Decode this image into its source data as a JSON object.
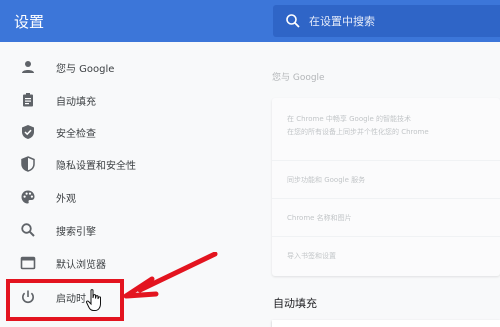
{
  "header": {
    "title": "设置",
    "search_placeholder": "在设置中搜索"
  },
  "sidebar": {
    "items": [
      {
        "label": "您与 Google",
        "icon": "person-icon"
      },
      {
        "label": "自动填充",
        "icon": "clipboard-icon"
      },
      {
        "label": "安全检查",
        "icon": "shield-check-icon"
      },
      {
        "label": "隐私设置和安全性",
        "icon": "shield-half-icon"
      },
      {
        "label": "外观",
        "icon": "palette-icon"
      },
      {
        "label": "搜索引擎",
        "icon": "search-icon"
      },
      {
        "label": "默认浏览器",
        "icon": "browser-icon"
      },
      {
        "label": "启动时",
        "icon": "power-icon"
      }
    ]
  },
  "main": {
    "section_title": "您与 Google",
    "rows": [
      {
        "line1": "在 Chrome 中畅享 Google 的智能技术",
        "line2": "在您的所有设备上同步并个性化您的 Chrome"
      },
      {
        "line1": "同步功能和 Google 服务"
      },
      {
        "line1": "Chrome 名称和图片"
      },
      {
        "line1": "导入书签和设置"
      }
    ],
    "autofill_title": "自动填充"
  },
  "annotation": {
    "highlight_color": "#e3141f"
  }
}
